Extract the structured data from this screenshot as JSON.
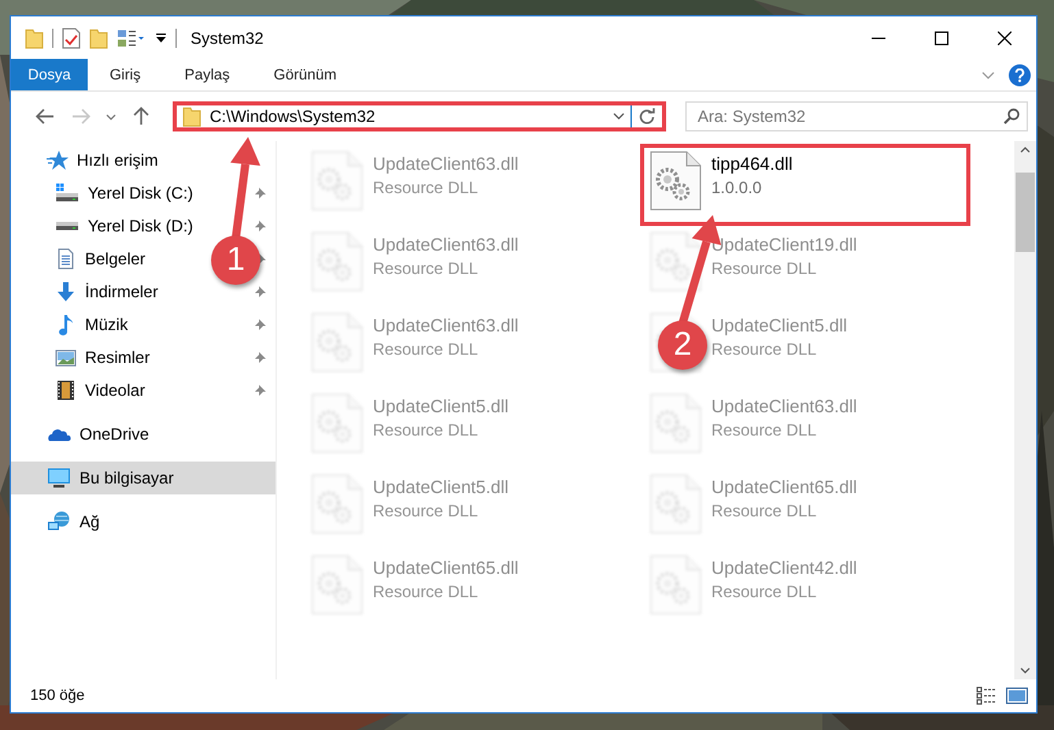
{
  "window": {
    "title": "System32"
  },
  "ribbon": {
    "tabs": [
      {
        "label": "Dosya",
        "selected": true
      },
      {
        "label": "Giriş",
        "selected": false
      },
      {
        "label": "Paylaş",
        "selected": false
      },
      {
        "label": "Görünüm",
        "selected": false
      }
    ]
  },
  "address_bar": {
    "path": "C:\\Windows\\System32",
    "highlighted": true
  },
  "search": {
    "placeholder": "Ara: System32"
  },
  "sidebar": {
    "items": [
      {
        "label": "Hızlı erişim",
        "kind": "star",
        "selected": false,
        "children": [
          {
            "label": "Yerel Disk (C:)",
            "kind": "system-drive",
            "pinned": true,
            "selected": false
          },
          {
            "label": "Yerel Disk (D:)",
            "kind": "drive",
            "pinned": true,
            "selected": false
          },
          {
            "label": "Belgeler",
            "kind": "documents",
            "pinned": true,
            "selected": false
          },
          {
            "label": "İndirmeler",
            "kind": "downloads",
            "pinned": true,
            "selected": false
          },
          {
            "label": "Müzik",
            "kind": "music",
            "pinned": true,
            "selected": false
          },
          {
            "label": "Resimler",
            "kind": "pictures",
            "pinned": true,
            "selected": false
          },
          {
            "label": "Videolar",
            "kind": "videos",
            "pinned": true,
            "selected": false
          }
        ]
      },
      {
        "label": "OneDrive",
        "kind": "cloud",
        "selected": false
      },
      {
        "label": "Bu bilgisayar",
        "kind": "computer",
        "selected": true
      },
      {
        "label": "Ağ",
        "kind": "network",
        "selected": false
      }
    ]
  },
  "files": [
    {
      "name": "UpdateClient63.dll",
      "detail": "Resource DLL",
      "dimmed": true,
      "highlighted": false
    },
    {
      "name": "tipp464.dll",
      "detail": "1.0.0.0",
      "dimmed": false,
      "highlighted": true
    },
    {
      "name": "UpdateClient63.dll",
      "detail": "Resource DLL",
      "dimmed": true,
      "highlighted": false
    },
    {
      "name": "UpdateClient19.dll",
      "detail": "Resource DLL",
      "dimmed": true,
      "highlighted": false
    },
    {
      "name": "UpdateClient63.dll",
      "detail": "Resource DLL",
      "dimmed": true,
      "highlighted": false
    },
    {
      "name": "UpdateClient5.dll",
      "detail": "Resource DLL",
      "dimmed": true,
      "highlighted": false
    },
    {
      "name": "UpdateClient5.dll",
      "detail": "Resource DLL",
      "dimmed": true,
      "highlighted": false
    },
    {
      "name": "UpdateClient63.dll",
      "detail": "Resource DLL",
      "dimmed": true,
      "highlighted": false
    },
    {
      "name": "UpdateClient5.dll",
      "detail": "Resource DLL",
      "dimmed": true,
      "highlighted": false
    },
    {
      "name": "UpdateClient65.dll",
      "detail": "Resource DLL",
      "dimmed": true,
      "highlighted": false
    },
    {
      "name": "UpdateClient65.dll",
      "detail": "Resource DLL",
      "dimmed": true,
      "highlighted": false
    },
    {
      "name": "UpdateClient42.dll",
      "detail": "Resource DLL",
      "dimmed": true,
      "highlighted": false
    }
  ],
  "status_bar": {
    "item_count": "150 öğe"
  },
  "annotations": [
    {
      "number": "1"
    },
    {
      "number": "2"
    }
  ]
}
